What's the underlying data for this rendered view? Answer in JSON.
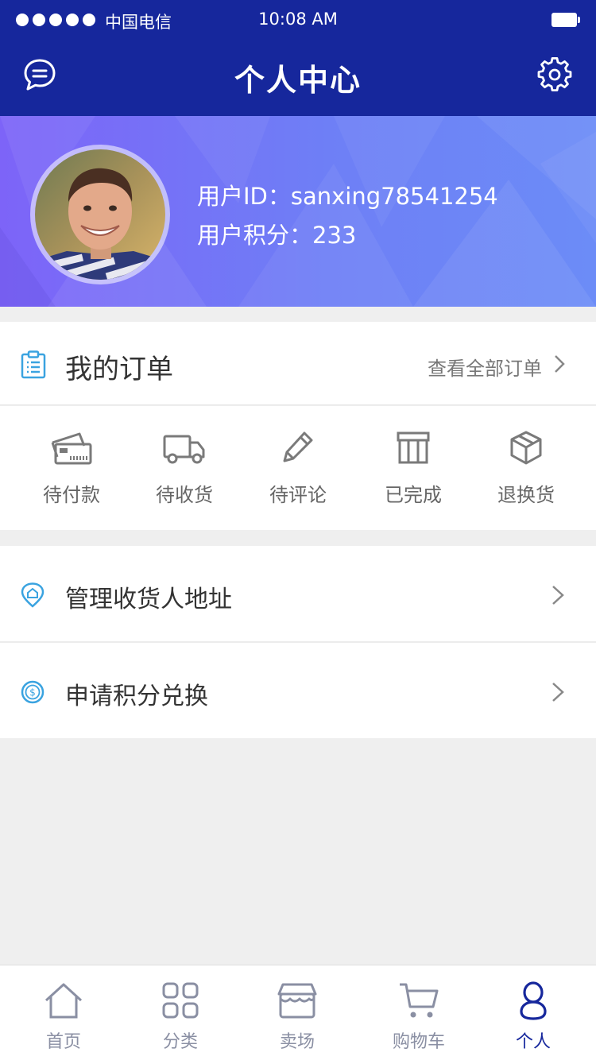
{
  "status_bar": {
    "carrier": "中国电信",
    "time": "10:08 AM",
    "signal_bars": 5
  },
  "nav": {
    "title": "个人中心",
    "left_icon": "message-icon",
    "right_icon": "gear-icon"
  },
  "profile": {
    "user_id": "用户ID：sanxing78541254",
    "user_points": "用户积分：233"
  },
  "orders": {
    "title": "我的订单",
    "view_all": "查看全部订单",
    "statuses": [
      {
        "label": "待付款",
        "icon": "payment-card-icon"
      },
      {
        "label": "待收货",
        "icon": "delivery-truck-icon"
      },
      {
        "label": "待评论",
        "icon": "pencil-icon"
      },
      {
        "label": "已完成",
        "icon": "completed-box-icon"
      },
      {
        "label": "退换货",
        "icon": "return-package-icon"
      }
    ]
  },
  "menu": [
    {
      "label": "管理收货人地址",
      "icon": "location-home-icon"
    },
    {
      "label": "申请积分兑换",
      "icon": "coin-icon"
    }
  ],
  "tabs": [
    {
      "label": "首页",
      "icon": "home-icon",
      "active": false
    },
    {
      "label": "分类",
      "icon": "category-grid-icon",
      "active": false
    },
    {
      "label": "卖场",
      "icon": "store-icon",
      "active": false
    },
    {
      "label": "购物车",
      "icon": "cart-icon",
      "active": false
    },
    {
      "label": "个人",
      "icon": "person-icon",
      "active": true
    }
  ],
  "colors": {
    "primary": "#16279c",
    "accent_icon": "#3aa3e0",
    "active_tab": "#16279c",
    "inactive_tab": "#8a8fa3"
  }
}
